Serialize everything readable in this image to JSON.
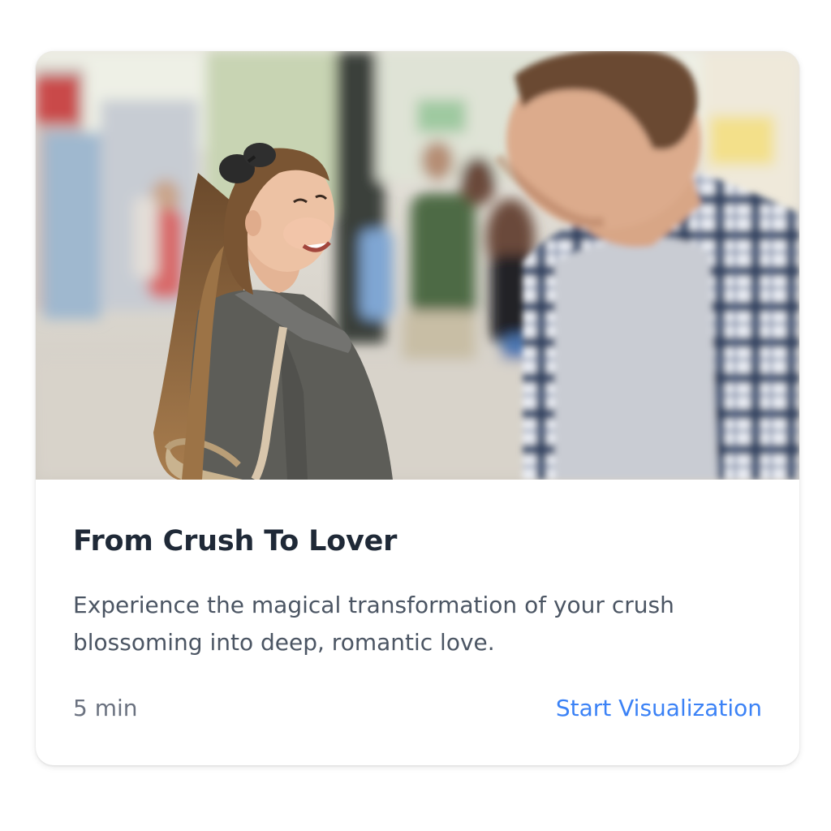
{
  "card": {
    "image_alt": "Woman looking back smiling at a man on a city street",
    "title": "From Crush To Lover",
    "description": "Experience the magical transformation of your crush blossoming into deep, romantic love.",
    "duration": "5 min",
    "action_label": "Start Visualization"
  },
  "colors": {
    "title": "#1f2937",
    "description": "#4b5563",
    "meta": "#6b7280",
    "link": "#3b82f6",
    "card_bg": "#ffffff"
  }
}
